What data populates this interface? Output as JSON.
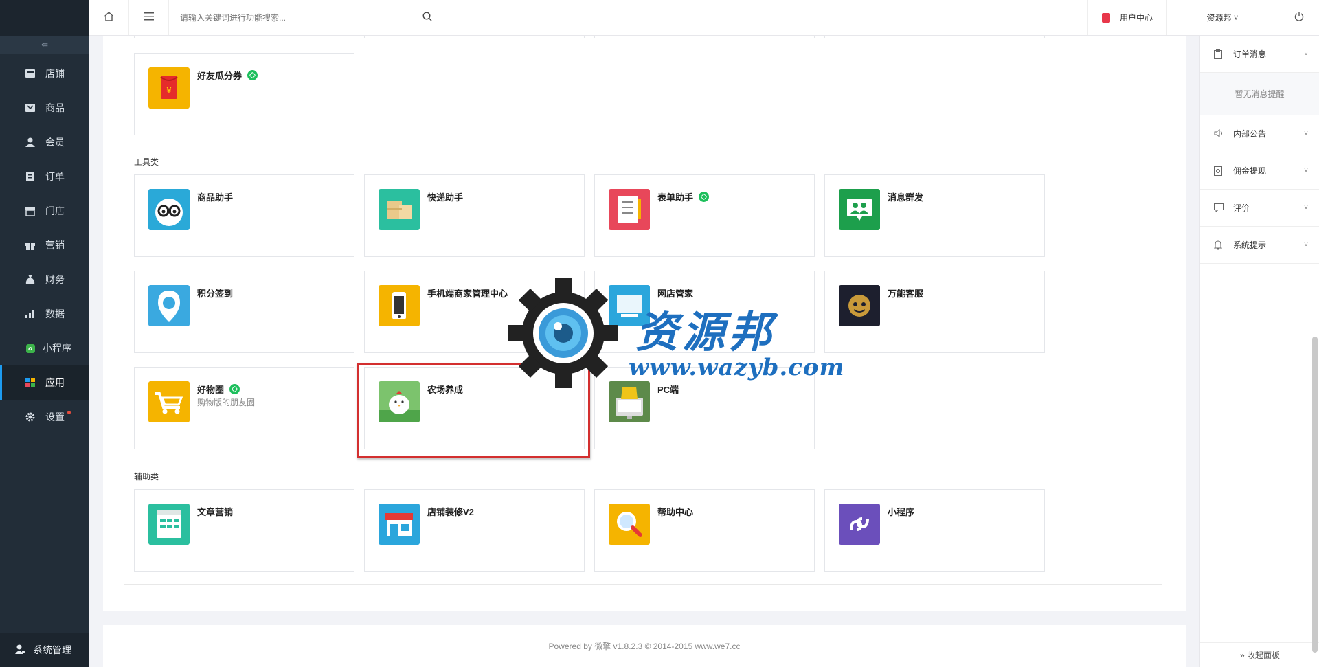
{
  "search": {
    "placeholder": "请输入关键词进行功能搜索..."
  },
  "sidebar": {
    "collapse_symbol": "⇚",
    "items": [
      {
        "label": "店铺",
        "icon": "store-icon"
      },
      {
        "label": "商品",
        "icon": "goods-icon"
      },
      {
        "label": "会员",
        "icon": "member-icon"
      },
      {
        "label": "订单",
        "icon": "order-icon"
      },
      {
        "label": "门店",
        "icon": "shop-icon"
      },
      {
        "label": "营销",
        "icon": "gift-icon"
      },
      {
        "label": "财务",
        "icon": "money-bag-icon"
      },
      {
        "label": "数据",
        "icon": "chart-icon"
      },
      {
        "label": "小程序",
        "icon": "miniprogram-icon"
      },
      {
        "label": "应用",
        "icon": "apps-icon",
        "active": true
      },
      {
        "label": "设置",
        "icon": "gear-icon"
      }
    ],
    "system": "系统管理"
  },
  "topbar": {
    "user_center": "用户中心",
    "account": "资源邦 ˅"
  },
  "sections": {
    "tools": "工具类",
    "aux": "辅助类"
  },
  "apps": {
    "hyg": {
      "name": "好友瓜分券",
      "color": "#f5b400"
    },
    "spzs": {
      "name": "商品助手",
      "color": "#2aa9d8"
    },
    "kdzs": {
      "name": "快递助手",
      "color": "#2bbf9f"
    },
    "bdzs": {
      "name": "表单助手",
      "color": "#e8475a"
    },
    "xxqf": {
      "name": "消息群发",
      "color": "#1d9f4c"
    },
    "jfqd": {
      "name": "积分签到",
      "color": "#3aa9e0"
    },
    "sjd": {
      "name": "手机端商家管理中心",
      "color": "#f5b400"
    },
    "wdgj": {
      "name": "网店管家",
      "color": "#2ba6dc"
    },
    "wnkf": {
      "name": "万能客服",
      "color": "#1d1f2e"
    },
    "hwq": {
      "name": "好物圈",
      "desc": "购物版的朋友圈",
      "color": "#f5b400"
    },
    "ncyc": {
      "name": "农场养成",
      "color": "#7cc36d"
    },
    "pc": {
      "name": "PC端",
      "color": "#5d8a4a"
    },
    "wzyx": {
      "name": "文章营销",
      "color": "#2bbf9f"
    },
    "dpzx": {
      "name": "店铺装修V2",
      "color": "#2ba6dc"
    },
    "bzzx": {
      "name": "帮助中心",
      "color": "#f5b400"
    },
    "xcx": {
      "name": "小程序",
      "color": "#6b4fbb"
    }
  },
  "footer": "Powered by 微擎 v1.8.2.3 © 2014-2015 www.we7.cc",
  "right_panel": {
    "order_msg": "订单消息",
    "empty": "暂无消息提醒",
    "notice": "内部公告",
    "commission": "佣金提现",
    "review": "评价",
    "system_tip": "系统提示",
    "collapse": "» 收起面板"
  },
  "watermark": {
    "cn": "资源邦",
    "url": "www.wazyb.com"
  }
}
